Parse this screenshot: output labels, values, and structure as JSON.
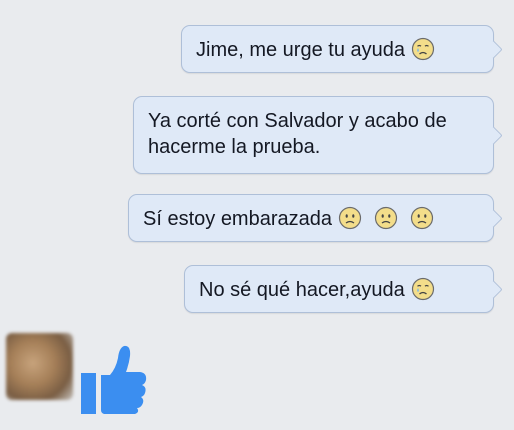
{
  "conversation": {
    "messages": [
      {
        "text": "Jime, me urge tu ayuda",
        "emojis": [
          "crying-face"
        ]
      },
      {
        "text": "Ya corté con Salvador y acabo de hacerme la prueba.",
        "emojis": []
      },
      {
        "text": "Sí estoy embarazada",
        "emojis": [
          "frowning-face",
          "frowning-face",
          "frowning-face"
        ]
      },
      {
        "text": "No sé qué hacer,ayuda",
        "emojis": [
          "crying-face"
        ]
      }
    ],
    "reply": {
      "sticker": "thumbs-up",
      "color": "#3b8ef0"
    }
  }
}
